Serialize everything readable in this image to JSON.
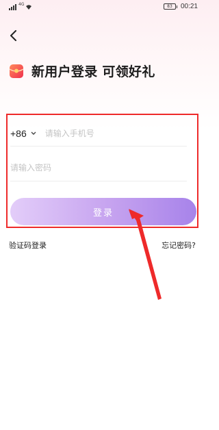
{
  "status_bar": {
    "network": "4G",
    "battery": "83",
    "time": "00:21"
  },
  "header": {
    "title": "新用户登录 可领好礼"
  },
  "form": {
    "country_code": "+86",
    "phone_placeholder": "请输入手机号",
    "password_placeholder": "请输入密码",
    "login_button": "登录"
  },
  "links": {
    "sms_login": "验证码登录",
    "forgot_password": "忘记密码?"
  },
  "colors": {
    "highlight_border": "#ee2a2a",
    "arrow": "#ee2a2a",
    "button_gradient_start": "#e3cdf9",
    "button_gradient_end": "#a783ea"
  }
}
